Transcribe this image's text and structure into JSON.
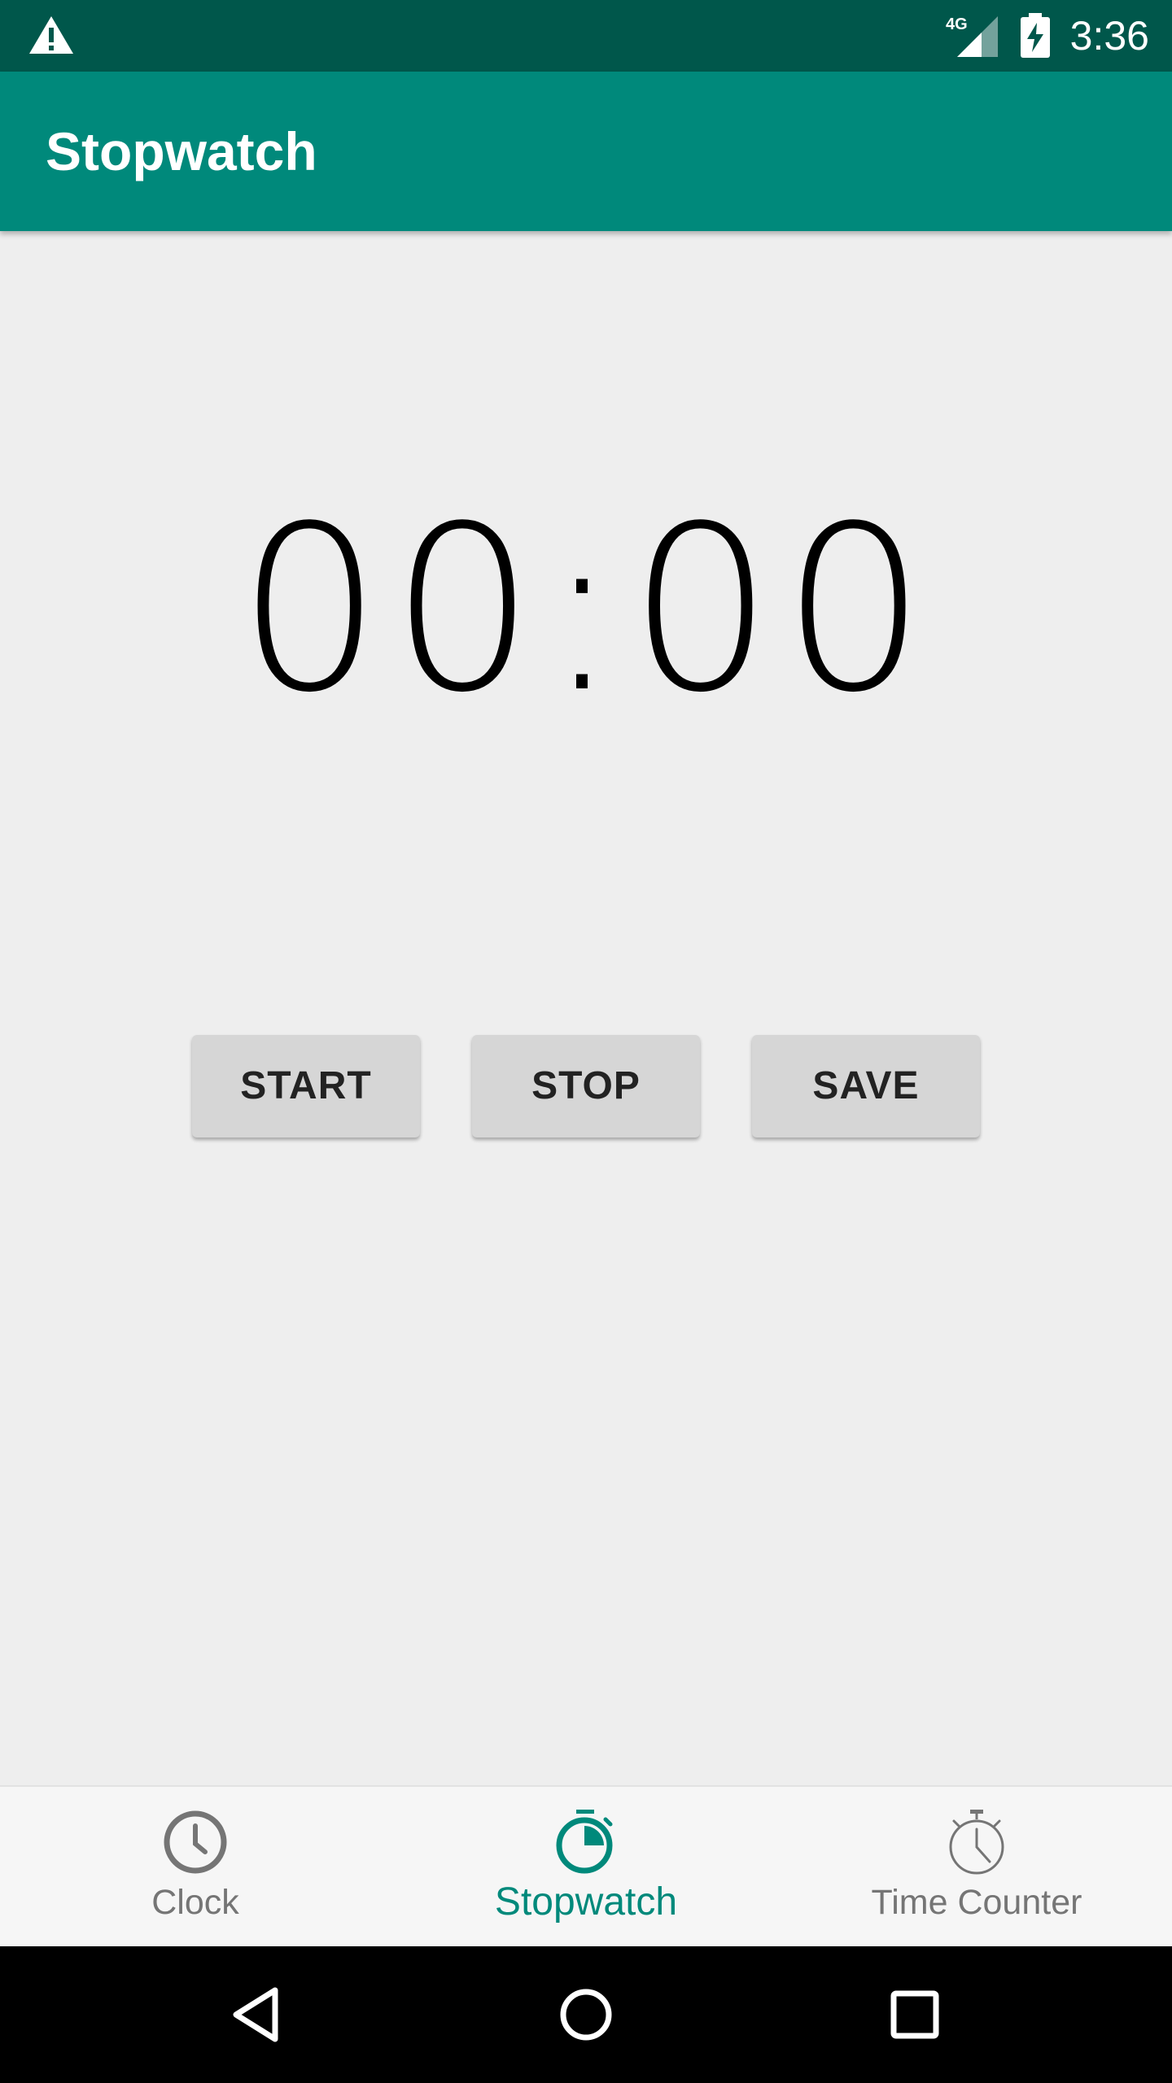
{
  "status_bar": {
    "time": "3:36",
    "network": "4G",
    "icons": [
      "warning-icon",
      "signal-icon",
      "battery-charging-icon"
    ]
  },
  "app_bar": {
    "title": "Stopwatch"
  },
  "timer": {
    "display": "00:00"
  },
  "controls": {
    "start_label": "START",
    "stop_label": "STOP",
    "save_label": "SAVE"
  },
  "bottom_nav": {
    "items": [
      {
        "label": "Clock",
        "icon": "clock-icon",
        "active": false
      },
      {
        "label": "Stopwatch",
        "icon": "stopwatch-icon",
        "active": true
      },
      {
        "label": "Time Counter",
        "icon": "timer-icon",
        "active": false
      }
    ]
  },
  "system_nav": {
    "icons": [
      "back-icon",
      "home-icon",
      "recents-icon"
    ]
  },
  "colors": {
    "primary": "#00897b",
    "primary_dark": "#00574b",
    "background": "#eeeeee",
    "button": "#d6d6d6",
    "inactive": "#757575"
  }
}
